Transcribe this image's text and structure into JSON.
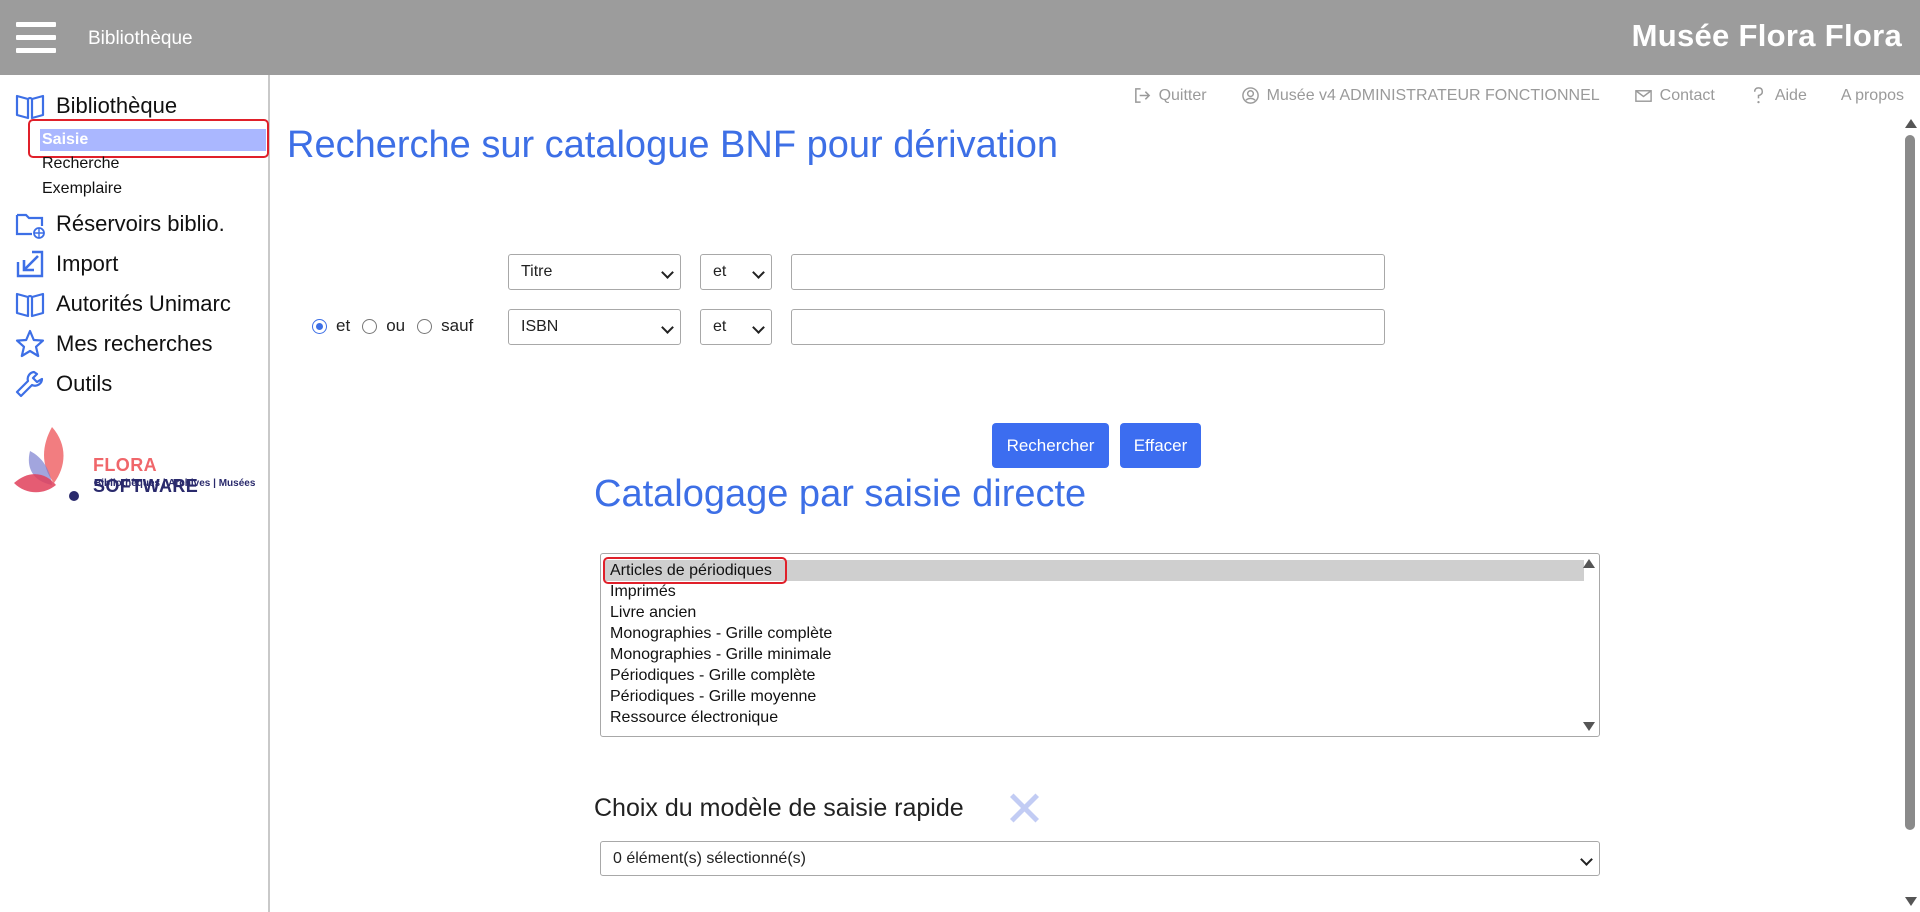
{
  "topbar": {
    "title": "Bibliothèque",
    "brand": "Musée Flora Flora"
  },
  "sidebar": {
    "items": [
      {
        "label": "Bibliothèque",
        "icon": "book-icon"
      },
      {
        "label": "Réservoirs biblio.",
        "icon": "folder-network-icon"
      },
      {
        "label": "Import",
        "icon": "import-arrow-icon"
      },
      {
        "label": "Autorités Unimarc",
        "icon": "book-icon"
      },
      {
        "label": "Mes recherches",
        "icon": "star-icon"
      },
      {
        "label": "Outils",
        "icon": "wrench-icon"
      }
    ],
    "subitems": [
      "Saisie",
      "Recherche",
      "Exemplaire"
    ],
    "logo": {
      "name_a": "FLORA ",
      "name_b": "SOFTWARE",
      "tagline": "Bibliothèques | Archives | Musées"
    }
  },
  "header_links": [
    "Quitter",
    "Musée v4 ADMINISTRATEUR FONCTIONNEL",
    "Contact",
    "Aide",
    "A propos"
  ],
  "search": {
    "title": "Recherche sur catalogue BNF pour dérivation",
    "row1": {
      "field": "Titre",
      "op": "et",
      "value": ""
    },
    "row2": {
      "field": "ISBN",
      "op": "et",
      "value": ""
    },
    "radios": [
      "et",
      "ou",
      "sauf"
    ],
    "selected_radio": "et",
    "search_button": "Rechercher",
    "clear_button": "Effacer"
  },
  "cataloging": {
    "title": "Catalogage par saisie directe",
    "options": [
      "Articles de périodiques",
      "Imprimés",
      "Livre ancien",
      "Monographies - Grille complète",
      "Monographies - Grille minimale",
      "Périodiques - Grille complète",
      "Périodiques - Grille moyenne",
      "Ressource électronique"
    ],
    "selected": "Articles de périodiques"
  },
  "quick_model": {
    "title": "Choix du modèle de saisie rapide",
    "select_value": "0 élément(s) sélectionné(s)"
  },
  "colors": {
    "topbar": "#9c9c9c",
    "accent": "#3d6fe6",
    "button": "#3c6df0",
    "highlight": "#e0202a"
  }
}
